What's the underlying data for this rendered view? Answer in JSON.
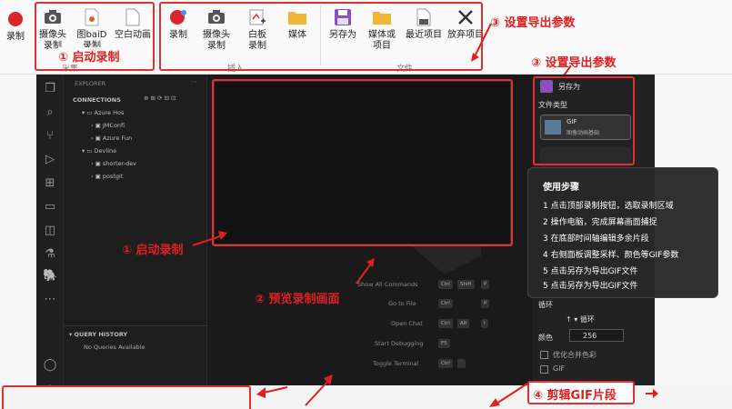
{
  "ribbon": {
    "record_left": "录制",
    "group1": [
      {
        "label": "摄像头\n录制",
        "icon": "camera-icon"
      },
      {
        "label": "图baiD录制",
        "icon": "screen-record-icon"
      },
      {
        "label": "空白动画",
        "icon": "blank-doc-icon"
      }
    ],
    "group1_label": "采集",
    "group2": [
      {
        "label": "录制",
        "icon": "record-icon"
      },
      {
        "label": "摄像头\n录制",
        "icon": "camera-icon"
      },
      {
        "label": "白板\n录制",
        "icon": "whiteboard-icon"
      },
      {
        "label": "媒体",
        "icon": "folder-icon"
      }
    ],
    "group2_label": "插入",
    "group3": [
      {
        "label": "另存为",
        "icon": "save-icon"
      },
      {
        "label": "媒体或\n项目",
        "icon": "folder-icon"
      },
      {
        "label": "最近项目",
        "icon": "recent-doc-icon"
      },
      {
        "label": "放弃项目",
        "icon": "close-icon"
      }
    ],
    "group3_label": "文件"
  },
  "annotations": {
    "a1_top": "① 启动录制",
    "a3_top": "③ 设置导出参数",
    "a3_right": "③ 设置导出参数",
    "a1_mid": "① 启动录制",
    "a2": "② 预览录制画面",
    "a4": "④ 剪辑GIF片段"
  },
  "sidebar": {
    "header": "EXPLORER",
    "section": "CONNECTIONS",
    "items": [
      "Azure Hos",
      "JMConfi",
      "Azure Fun",
      "Devline",
      "shorter-dev",
      "postgit"
    ],
    "query_history": "QUERY HISTORY",
    "no_queries": "No Queries Available"
  },
  "editor": {
    "commands": [
      {
        "label": "Show All Commands",
        "keys": [
          "Ctrl",
          "Shift",
          "P"
        ]
      },
      {
        "label": "Go to File",
        "keys": [
          "Ctrl",
          "P"
        ]
      },
      {
        "label": "Open Chat",
        "keys": [
          "Ctrl",
          "Alt",
          "I"
        ]
      },
      {
        "label": "Start Debugging",
        "keys": [
          "F5"
        ]
      },
      {
        "label": "Toggle Terminal",
        "keys": [
          "Ctrl",
          "`"
        ]
      }
    ]
  },
  "right_panel": {
    "save_as": "另存为",
    "file_type": "文件类型",
    "gif_label": "GIF",
    "gif_desc": "图像动画基础",
    "loop_label": "循环",
    "loop_value": "循环",
    "colors_label": "颜色",
    "colors_value": "256",
    "checkbox1": "优化合并色彩",
    "checkbox2": "GIF"
  },
  "tooltip": {
    "title": "使用步骤",
    "steps": [
      "1 点击顶部录制按钮，选取录制区域",
      "2 操作电脑，完成屏幕画面捕捉",
      "3 在底部时间轴编辑多余片段",
      "4 右侧面板调整采样、颜色等GIF参数",
      "5 点击另存为导出GIF文件",
      "5 点击另存为导出GIF文件"
    ]
  },
  "colors": {
    "accent_red": "#e02020",
    "dark_bg": "#1b1b1b"
  }
}
